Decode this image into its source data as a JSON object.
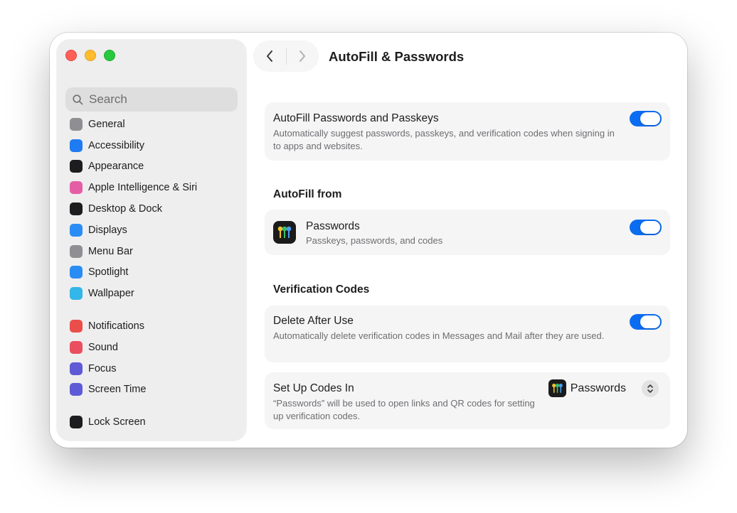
{
  "window": {
    "title": "AutoFill & Passwords"
  },
  "sidebar": {
    "search_placeholder": "Search",
    "groups": [
      [
        {
          "label": "General",
          "icon": "gear-icon",
          "color": "#8e8e93"
        },
        {
          "label": "Accessibility",
          "icon": "accessibility-icon",
          "color": "#1f7bf2"
        },
        {
          "label": "Appearance",
          "icon": "appearance-icon",
          "color": "#1d1d1f"
        },
        {
          "label": "Apple Intelligence & Siri",
          "icon": "apple-intelligence-icon",
          "color": "#e45ea6"
        },
        {
          "label": "Desktop & Dock",
          "icon": "desktop-dock-icon",
          "color": "#1d1d1f"
        },
        {
          "label": "Displays",
          "icon": "displays-icon",
          "color": "#2a8df5"
        },
        {
          "label": "Menu Bar",
          "icon": "menu-bar-icon",
          "color": "#8e8e93"
        },
        {
          "label": "Spotlight",
          "icon": "spotlight-icon",
          "color": "#2a8df5"
        },
        {
          "label": "Wallpaper",
          "icon": "wallpaper-icon",
          "color": "#33b6e8"
        }
      ],
      [
        {
          "label": "Notifications",
          "icon": "notifications-icon",
          "color": "#ea4e4a"
        },
        {
          "label": "Sound",
          "icon": "sound-icon",
          "color": "#ea4e5f"
        },
        {
          "label": "Focus",
          "icon": "focus-icon",
          "color": "#5f5ad6"
        },
        {
          "label": "Screen Time",
          "icon": "screen-time-icon",
          "color": "#5f5ad6"
        }
      ],
      [
        {
          "label": "Lock Screen",
          "icon": "lock-icon",
          "color": "#1d1d1f"
        }
      ]
    ]
  },
  "autofill": {
    "title": "AutoFill Passwords and Passkeys",
    "description": "Automatically suggest passwords, passkeys, and verification codes when signing in to apps and websites.",
    "enabled": true
  },
  "autofill_from": {
    "heading": "AutoFill from",
    "app_name": "Passwords",
    "app_desc": "Passkeys, passwords, and codes",
    "enabled": true
  },
  "verification": {
    "heading": "Verification Codes",
    "delete_title": "Delete After Use",
    "delete_desc": "Automatically delete verification codes in Messages and Mail after they are used.",
    "delete_enabled": true,
    "setup_title": "Set Up Codes In",
    "setup_desc": "“Passwords” will be used to open links and QR codes for setting up verification codes.",
    "setup_value": "Passwords"
  },
  "colors": {
    "accent": "#0a6cf0",
    "close": "#ff5f57",
    "minimize": "#febc2e",
    "maximize": "#28c840"
  }
}
